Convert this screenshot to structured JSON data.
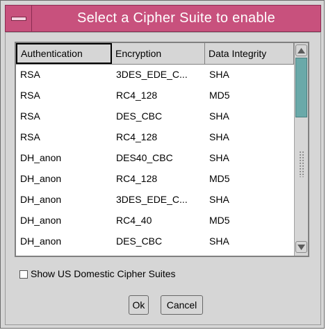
{
  "dialog": {
    "title": "Select a Cipher Suite to enable"
  },
  "table": {
    "columns": [
      "Authentication",
      "Encryption",
      "Data Integrity"
    ],
    "rows": [
      [
        "RSA",
        "3DES_EDE_C...",
        "SHA"
      ],
      [
        "RSA",
        "RC4_128",
        "MD5"
      ],
      [
        "RSA",
        "DES_CBC",
        "SHA"
      ],
      [
        "RSA",
        "RC4_128",
        "SHA"
      ],
      [
        "DH_anon",
        "DES40_CBC",
        "SHA"
      ],
      [
        "DH_anon",
        "RC4_128",
        "MD5"
      ],
      [
        "DH_anon",
        "3DES_EDE_C...",
        "SHA"
      ],
      [
        "DH_anon",
        "RC4_40",
        "MD5"
      ],
      [
        "DH_anon",
        "DES_CBC",
        "SHA"
      ]
    ]
  },
  "options": {
    "show_domestic_label": "Show US Domestic Cipher Suites",
    "show_domestic_checked": false
  },
  "buttons": {
    "ok": "Ok",
    "cancel": "Cancel"
  },
  "colors": {
    "titlebar": "#c8517d",
    "scroll_thumb": "#6aa9a9"
  }
}
